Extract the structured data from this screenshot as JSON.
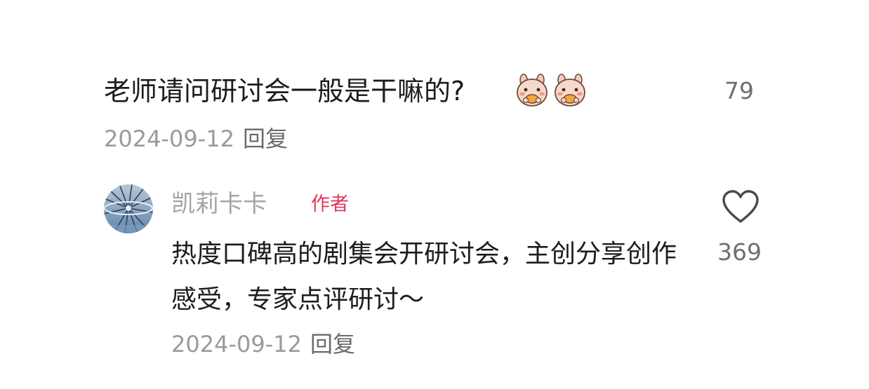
{
  "comment": {
    "text": "老师请问研讨会一般是干嘛的?",
    "sticker_icons": [
      "bunny-eating-sticker",
      "bunny-eating-sticker"
    ],
    "like_count": "79",
    "date": "2024-09-12",
    "reply_label": "回复"
  },
  "reply": {
    "username": "凯莉卡卡",
    "author_badge": "作者",
    "text": "热度口碑高的剧集会开研讨会，主创分享创作感受，专家点评研讨～",
    "like_icon": "heart-outline-icon",
    "like_count": "369",
    "date": "2024-09-12",
    "reply_label": "回复"
  },
  "colors": {
    "primary_text": "#1c1c1e",
    "secondary_text": "#9a9a9e",
    "author_badge": "#e0385a",
    "username": "#a4a4a8"
  }
}
